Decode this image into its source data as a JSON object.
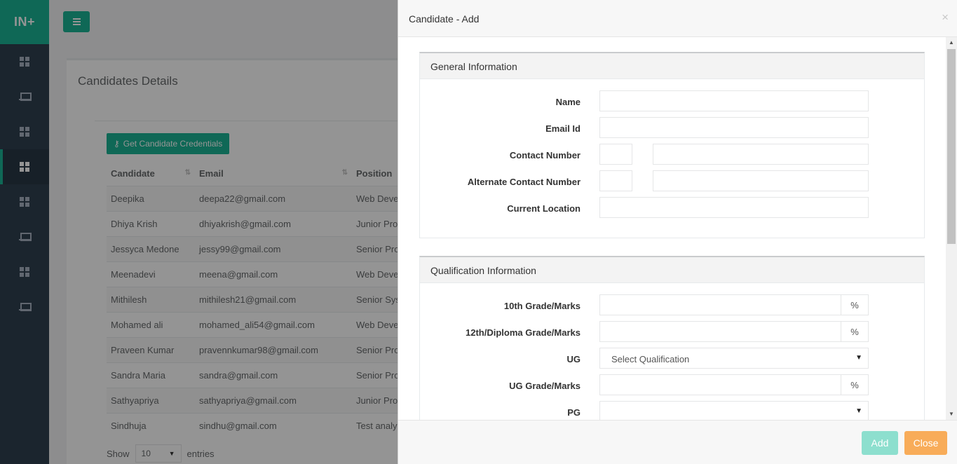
{
  "app": {
    "logo": "IN+"
  },
  "page": {
    "title": "Candidates Details",
    "credentials_button": "Get Candidate Credentials",
    "columns": [
      "Candidate",
      "Email",
      "Position"
    ],
    "rows": [
      [
        "Deepika",
        "deepa22@gmail.com",
        "Web Deve"
      ],
      [
        "Dhiya Krish",
        "dhiyakrish@gmail.com",
        "Junior Pro"
      ],
      [
        "Jessyca Medone",
        "jessy99@gmail.com",
        "Senior Pro"
      ],
      [
        "Meenadevi",
        "meena@gmail.com",
        "Web Deve"
      ],
      [
        "Mithilesh",
        "mithilesh21@gmail.com",
        "Senior Sys"
      ],
      [
        "Mohamed ali",
        "mohamed_ali54@gmail.com",
        "Web Deve"
      ],
      [
        "Praveen Kumar",
        "pravennkumar98@gmail.com",
        "Senior Pro"
      ],
      [
        "Sandra Maria",
        "sandra@gmail.com",
        "Senior Pro"
      ],
      [
        "Sathyapriya",
        "sathyapriya@gmail.com",
        "Junior Pro"
      ],
      [
        "Sindhuja",
        "sindhu@gmail.com",
        "Test analy"
      ]
    ],
    "show_label": "Show",
    "entries_value": "10",
    "entries_label": "entries"
  },
  "modal": {
    "title": "Candidate - Add",
    "close_glyph": "×",
    "general": {
      "heading": "General Information",
      "name_label": "Name",
      "email_label": "Email Id",
      "contact_label": "Contact Number",
      "alt_contact_label": "Alternate Contact Number",
      "location_label": "Current Location"
    },
    "qualification": {
      "heading": "Qualification Information",
      "tenth_label": "10th Grade/Marks",
      "twelfth_label": "12th/Diploma Grade/Marks",
      "ug_label": "UG",
      "ug_placeholder": "Select Qualification",
      "ug_marks_label": "UG Grade/Marks",
      "pg_label": "PG",
      "percent": "%"
    },
    "add_button": "Add",
    "close_button": "Close"
  },
  "colors": {
    "brand": "#1ab394",
    "sidebar": "#2f4050",
    "add_button": "#8ddfce",
    "close_button": "#f8ac59"
  }
}
